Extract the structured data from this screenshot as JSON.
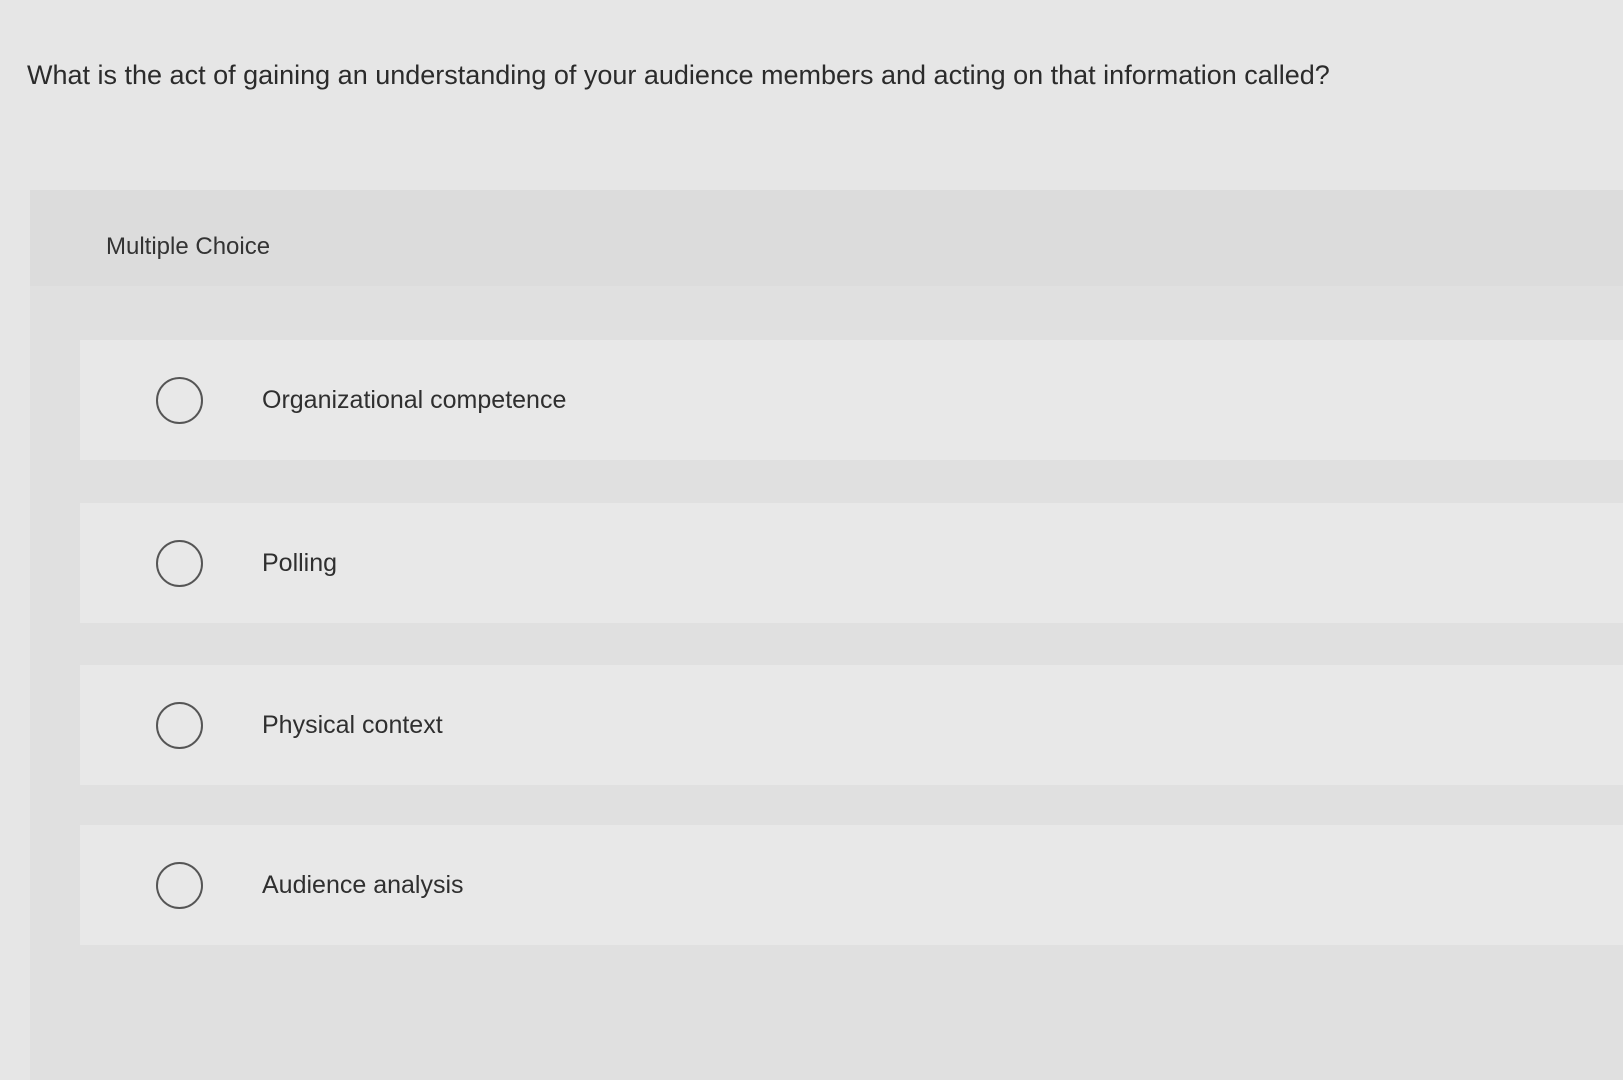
{
  "question": {
    "text": "What is the act of gaining an understanding of your audience members and acting on that information called?"
  },
  "panel": {
    "label": "Multiple Choice"
  },
  "options": [
    {
      "label": "Organizational competence",
      "selected": false
    },
    {
      "label": "Polling",
      "selected": false
    },
    {
      "label": "Physical context",
      "selected": false
    },
    {
      "label": "Audience analysis",
      "selected": false
    }
  ]
}
